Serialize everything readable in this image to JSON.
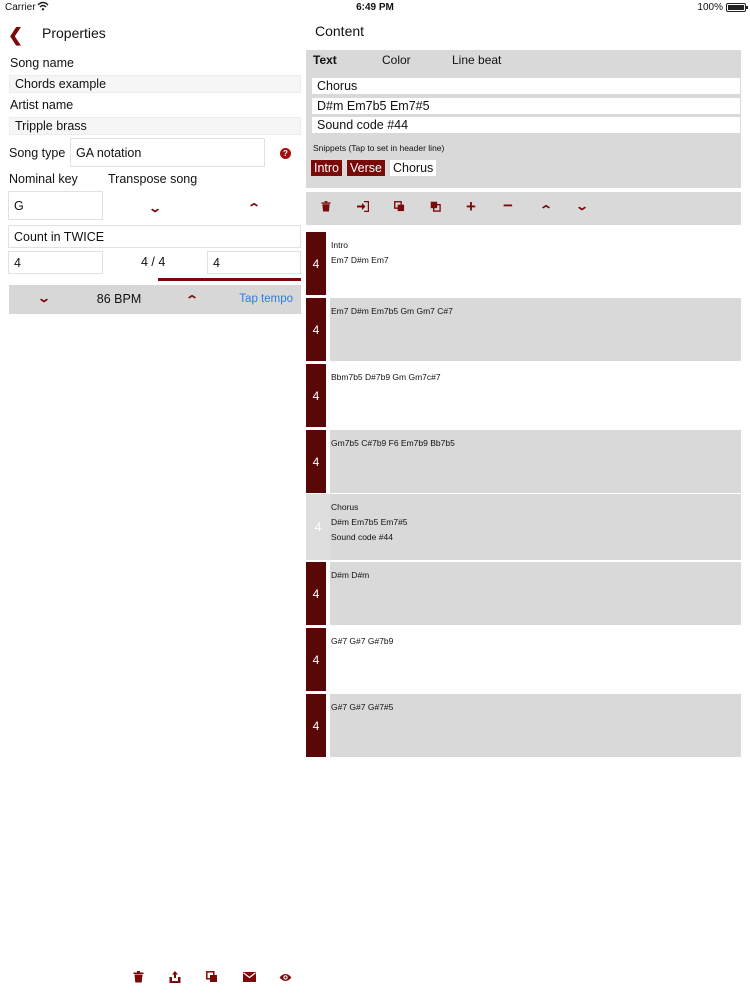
{
  "status": {
    "carrier": "Carrier",
    "time": "6:49 PM",
    "battery": "100%"
  },
  "left": {
    "title": "Properties",
    "song_name_label": "Song name",
    "song_name_value": "Chords example",
    "artist_label": "Artist name",
    "artist_value": "Tripple brass",
    "song_type_label": "Song type",
    "song_type_value": "GA notation",
    "nominal_key_label": "Nominal key",
    "transpose_label": "Transpose song",
    "key_value": "G",
    "count_in_value": "Count in TWICE",
    "beats_value": "4",
    "signature": "4 / 4",
    "signature_value": "4",
    "bpm": "86 BPM",
    "tap_tempo": "Tap tempo"
  },
  "right": {
    "title": "Content",
    "tabs": [
      {
        "label": "Text"
      },
      {
        "label": "Color"
      },
      {
        "label": "Line beat"
      }
    ],
    "header_line_1": "Chorus",
    "header_line_2": "D#m Em7b5 Em7#5",
    "header_line_3": "Sound code #44",
    "snippets_hint": "Snippets (Tap to set in header line)",
    "snippets": [
      {
        "label": "Intro"
      },
      {
        "label": "Verse"
      },
      {
        "label": "Chorus"
      }
    ],
    "rows": [
      {
        "beat": "4",
        "lines": [
          "Intro",
          "Em7 D#m Em7"
        ]
      },
      {
        "beat": "4",
        "lines": [
          "Em7 D#m Em7b5 Gm Gm7 C#7"
        ]
      },
      {
        "beat": "4",
        "lines": [
          "Bbm7b5 D#7b9 Gm Gm7c#7"
        ]
      },
      {
        "beat": "4",
        "lines": [
          "Gm7b5 C#7b9 F6 Em7b9 Bb7b5"
        ]
      },
      {
        "beat": "4",
        "lines": [
          "Chorus",
          "D#m Em7b5 Em7#5",
          "Sound code #44"
        ]
      },
      {
        "beat": "4",
        "lines": [
          "D#m D#m"
        ]
      },
      {
        "beat": "4",
        "lines": [
          "G#7 G#7 G#7b9"
        ]
      },
      {
        "beat": "4",
        "lines": [
          "G#7 G#7 G#7#5"
        ]
      }
    ]
  },
  "colors": {
    "accent": "#7a0a0a",
    "panel_gray": "#d9d9d9",
    "link": "#2d7ed6"
  }
}
